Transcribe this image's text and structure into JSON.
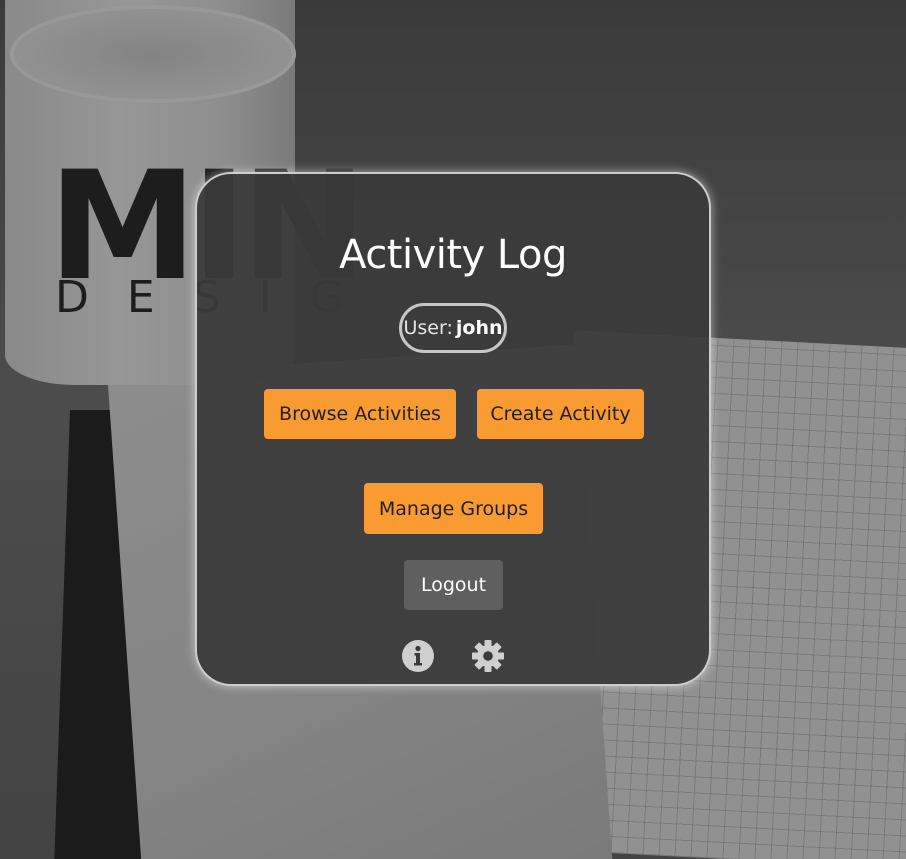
{
  "header": {
    "title": "Activity Log"
  },
  "user": {
    "label": "User:",
    "name": "john"
  },
  "actions": {
    "browse_label": "Browse Activities",
    "create_label": "Create Activity",
    "groups_label": "Manage Groups",
    "logout_label": "Logout"
  },
  "footer_icons": {
    "info": "info-icon",
    "settings": "gear-icon"
  },
  "colors": {
    "accent": "#fa9b32",
    "card_bg": "#3a3a3a",
    "logout_bg": "#5f5f5f",
    "icon": "#cfcfcf"
  },
  "background": {
    "mug_text_line1": "MIN",
    "mug_text_line2": "DESIG"
  }
}
